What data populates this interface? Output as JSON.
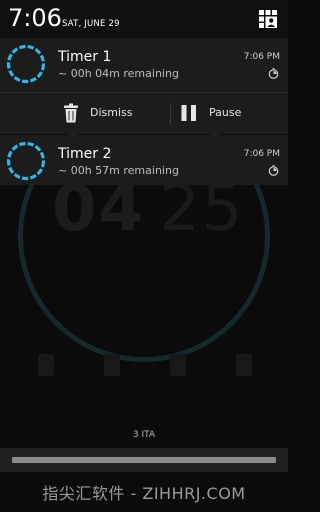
{
  "status_bar": {
    "time": "7:06",
    "date": "SAT, JUNE 29"
  },
  "notifications": [
    {
      "title": "Timer 1",
      "subtitle": "~ 00h 04m remaining",
      "time": "7:06 PM",
      "actions": [
        {
          "label": "Dismiss",
          "icon": "trash-icon"
        },
        {
          "label": "Pause",
          "icon": "pause-icon"
        }
      ]
    },
    {
      "title": "Timer 2",
      "subtitle": "~ 00h 57m remaining",
      "time": "7:06 PM"
    }
  ],
  "background_app": {
    "digits_main": "04",
    "digits_sec": "25",
    "label": "3 ITA",
    "bottom_text": "指尖汇软件 - ZIHHRJ.COM"
  },
  "colors": {
    "accent": "#33b5e5",
    "shade_bg": "#1c1c1c",
    "header_bg": "#101010"
  }
}
